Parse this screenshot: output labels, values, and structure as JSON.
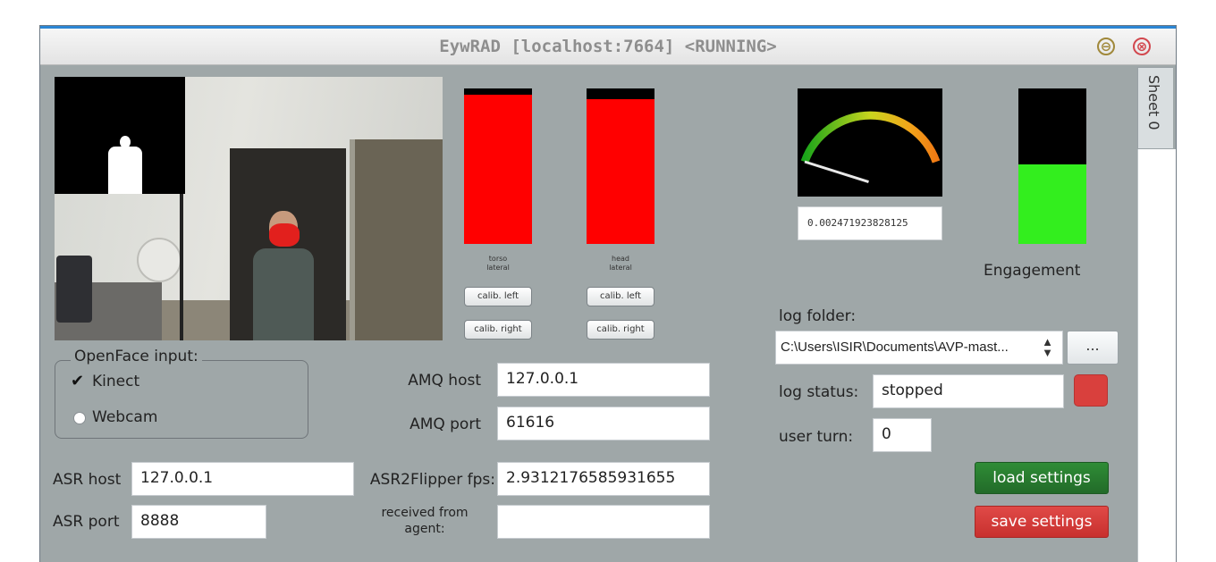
{
  "window": {
    "title": "EywRAD [localhost:7664] <RUNNING>",
    "minimize_glyph": "⊖",
    "close_glyph": "⊗"
  },
  "tab": {
    "label": "Sheet 0"
  },
  "camera": {
    "icon": "camera-feed-icon"
  },
  "lateral": [
    {
      "label_1": "torso",
      "label_2": "lateral",
      "level": 0.96,
      "calib_left": "calib. left",
      "calib_right": "calib. right"
    },
    {
      "label_1": "head",
      "label_2": "lateral",
      "level": 0.93,
      "calib_left": "calib. left",
      "calib_right": "calib. right"
    }
  ],
  "gauge": {
    "value": "0.002471923828125",
    "needle_fraction": 0.002471923828125
  },
  "engagement": {
    "label": "Engagement",
    "level": 0.51,
    "color": "#33ee1e"
  },
  "openface": {
    "title": "OpenFace input:",
    "options": [
      {
        "label": "Kinect",
        "checked": true,
        "check_glyph": "✔"
      },
      {
        "label": "Webcam",
        "checked": false
      }
    ]
  },
  "asr": {
    "host_label": "ASR host",
    "host_value": "127.0.0.1",
    "port_label": "ASR port",
    "port_value": "8888"
  },
  "amq": {
    "host_label": "AMQ host",
    "host_value": "127.0.0.1",
    "port_label": "AMQ port",
    "port_value": "61616"
  },
  "flipper": {
    "fps_label": "ASR2Flipper fps:",
    "fps_value": "2.9312176585931655"
  },
  "agent": {
    "received_label_1": "received from",
    "received_label_2": "agent:",
    "received_value": ""
  },
  "log": {
    "folder_label": "log folder:",
    "folder_value": "C:\\Users\\ISIR\\Documents\\AVP-mast...",
    "browse_label": "...",
    "status_label": "log status:",
    "status_value": "stopped",
    "status_color": "#d9403d",
    "turn_label": "user turn:",
    "turn_value": "0"
  },
  "buttons": {
    "load": "load settings",
    "save": "save settings",
    "load_color": "#2f8c36",
    "save_color": "#e04a47"
  }
}
